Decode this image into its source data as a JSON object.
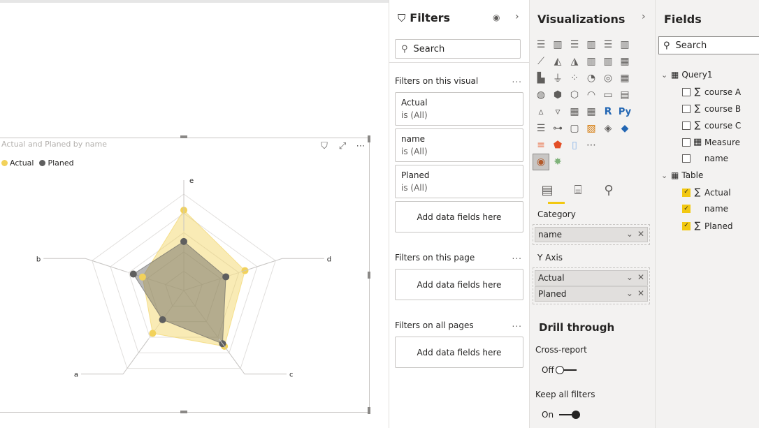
{
  "canvas": {
    "visual_title": "Actual and Planed by name",
    "legend": [
      {
        "label": "Actual",
        "color": "#f2d25b"
      },
      {
        "label": "Planed",
        "color": "#5f5f5f"
      }
    ],
    "toolbar_icons": [
      "filter-icon",
      "focus-mode-icon",
      "more-options-icon"
    ]
  },
  "chart_data": {
    "type": "radar",
    "categories": [
      "e",
      "d",
      "c",
      "a",
      "b"
    ],
    "series": [
      {
        "name": "Actual",
        "color": "#f2d25b",
        "values": [
          10,
          8,
          8.6,
          6.6,
          5.4
        ]
      },
      {
        "name": "Planed",
        "color": "#5f5f5f",
        "values": [
          6.1,
          5.5,
          8.2,
          4.5,
          6.6
        ]
      }
    ],
    "range": [
      0,
      12
    ]
  },
  "filters": {
    "title": "Filters",
    "search_placeholder": "Search",
    "on_visual_label": "Filters on this visual",
    "visual_cards": [
      {
        "field": "Actual",
        "state": "is (All)"
      },
      {
        "field": "name",
        "state": "is (All)"
      },
      {
        "field": "Planed",
        "state": "is (All)"
      }
    ],
    "add_fields": "Add data fields here",
    "on_page_label": "Filters on this page",
    "all_pages_label": "Filters on all pages",
    "more": "..."
  },
  "viz": {
    "title": "Visualizations",
    "category_label": "Category",
    "category_field": "name",
    "yaxis_label": "Y Axis",
    "yaxis_fields": [
      "Actual",
      "Planed"
    ],
    "drill_title": "Drill through",
    "cross_report_label": "Cross-report",
    "cross_report_state": "Off",
    "keep_filters_label": "Keep all filters",
    "keep_filters_state": "On",
    "r_label": "R",
    "py_label": "Py"
  },
  "fields": {
    "title": "Fields",
    "search_placeholder": "Search",
    "tables": [
      {
        "name": "Query1",
        "items": [
          {
            "label": "course A",
            "sigma": true,
            "checked": false
          },
          {
            "label": "course B",
            "sigma": true,
            "checked": false
          },
          {
            "label": "course C",
            "sigma": true,
            "checked": false
          },
          {
            "label": "Measure",
            "sigma": false,
            "checked": false
          },
          {
            "label": "name",
            "sigma": false,
            "checked": false
          }
        ]
      },
      {
        "name": "Table",
        "items": [
          {
            "label": "Actual",
            "sigma": true,
            "checked": true
          },
          {
            "label": "name",
            "sigma": false,
            "checked": true
          },
          {
            "label": "Planed",
            "sigma": true,
            "checked": true
          }
        ]
      }
    ]
  }
}
